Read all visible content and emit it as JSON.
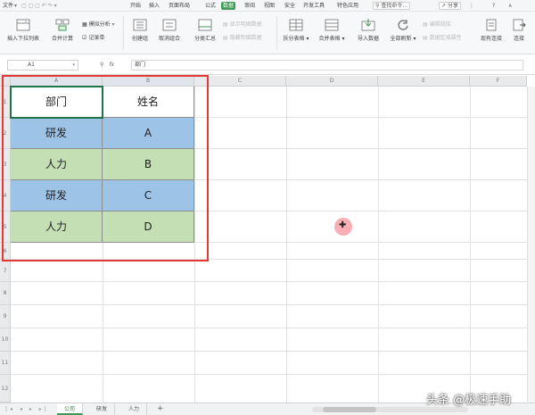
{
  "menu": {
    "file": "文件",
    "items": [
      "开始",
      "插入",
      "页面布局",
      "公式",
      "数据",
      "审阅",
      "视图",
      "安全",
      "开发工具",
      "特色应用"
    ],
    "active": "数据",
    "search": "查找命令...",
    "share": "分享"
  },
  "ribbon": {
    "insert_dropdown": "插入下拉列表",
    "merge_calc": "合并计算",
    "simulate": "模拟分析",
    "record": "记录单",
    "create_group": "创建组",
    "ungroup": "取消组合",
    "subtotal": "分类汇总",
    "show_detail": "显示明细数据",
    "hide_detail": "隐藏明细数据",
    "split_table": "拆分表格",
    "merge_table": "合并表格",
    "import_data": "导入数据",
    "refresh_all": "全部刷新",
    "edit_links": "编辑链接",
    "data_area_props": "数据区域属性",
    "existing_conn": "现有连接",
    "connect": "连接"
  },
  "formula_bar": {
    "name_box": "A1",
    "fx_label": "fx",
    "content": "部门"
  },
  "columns": [
    "A",
    "B",
    "C",
    "D",
    "E",
    "F"
  ],
  "rows": [
    "1",
    "2",
    "3",
    "4",
    "5",
    "6",
    "7",
    "8",
    "9",
    "10",
    "11",
    "12"
  ],
  "table": {
    "header": [
      "部门",
      "姓名"
    ],
    "rows": [
      [
        "研发",
        "A"
      ],
      [
        "人力",
        "B"
      ],
      [
        "研发",
        "C"
      ],
      [
        "人力",
        "D"
      ]
    ]
  },
  "sheet_tabs": [
    "公司",
    "研发",
    "人力"
  ],
  "active_sheet": "公司",
  "add_sheet": "+",
  "watermark": "头条 @极速手助",
  "colors": {
    "accent": "#3e9a55",
    "blue_row": "#9dc3e6",
    "green_row": "#c5dfb4",
    "highlight_box": "#e53935"
  }
}
